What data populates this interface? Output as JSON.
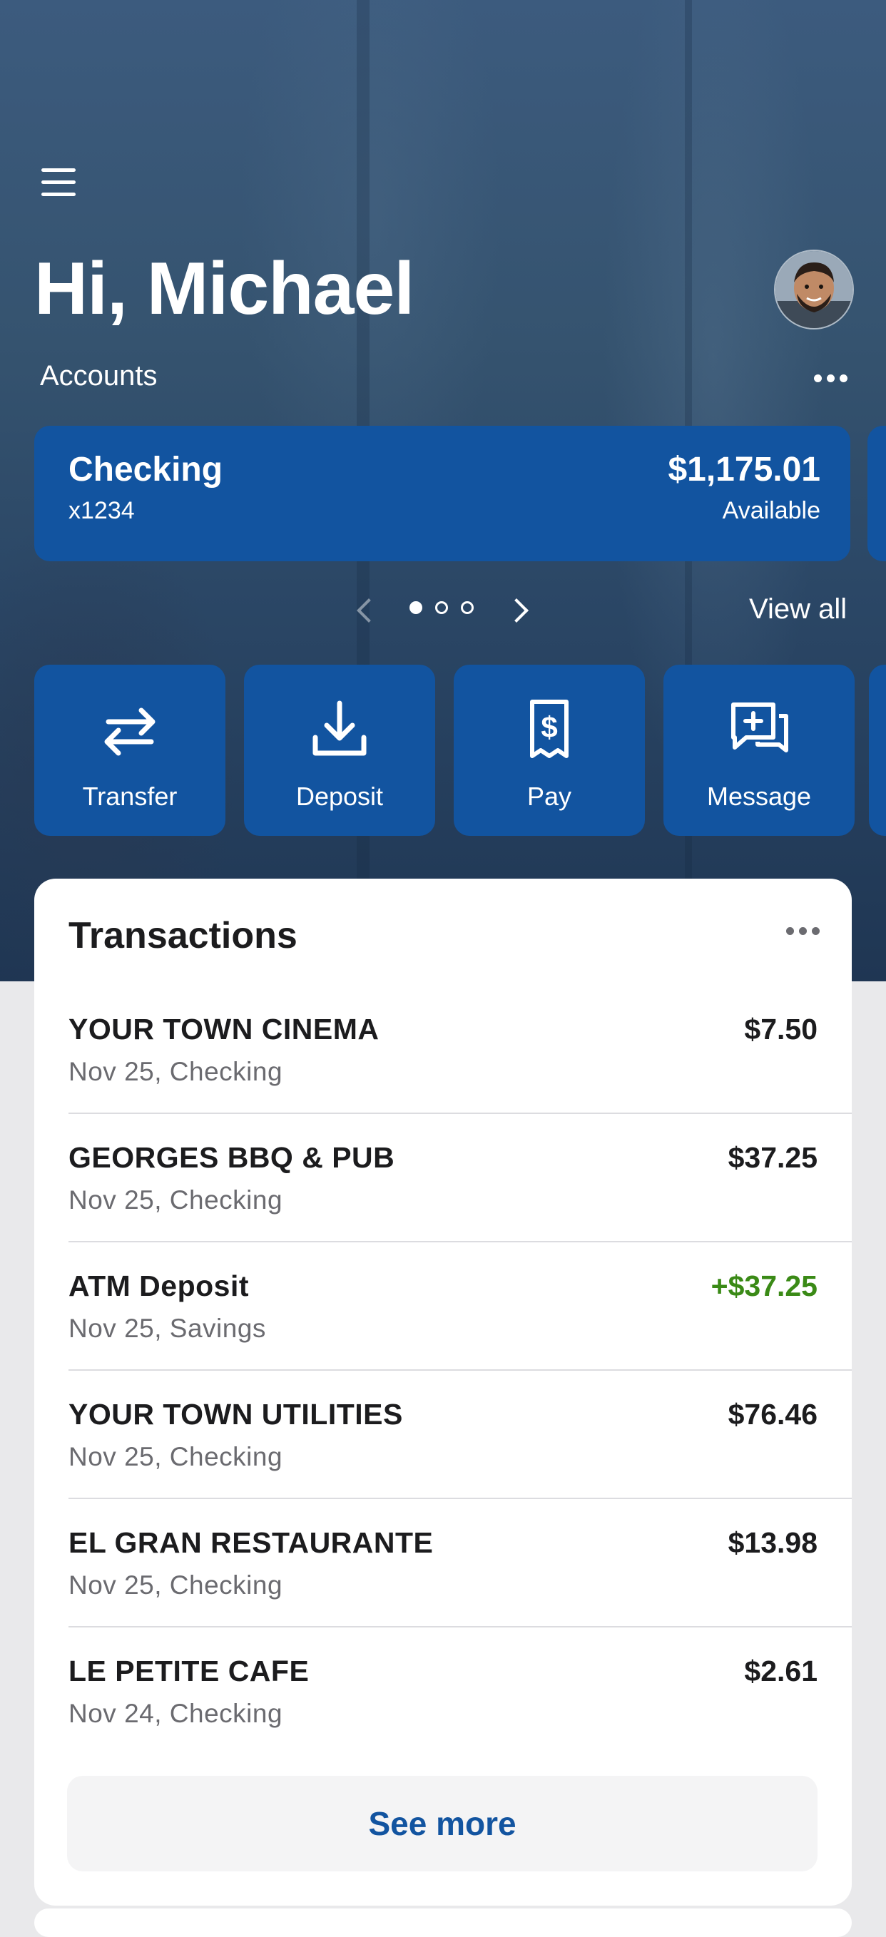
{
  "greeting": "Hi, Michael",
  "accounts": {
    "label": "Accounts",
    "cards": [
      {
        "name": "Checking",
        "number": "x1234",
        "balance": "$1,175.01",
        "balance_label": "Available"
      }
    ],
    "pager": {
      "total_pages": 3,
      "current_page": 1
    },
    "view_all_label": "View all"
  },
  "actions": [
    {
      "label": "Transfer",
      "icon": "transfer-arrows-icon"
    },
    {
      "label": "Deposit",
      "icon": "download-tray-icon"
    },
    {
      "label": "Pay",
      "icon": "receipt-dollar-icon"
    },
    {
      "label": "Message",
      "icon": "chat-plus-icon"
    }
  ],
  "transactions": {
    "title": "Transactions",
    "items": [
      {
        "description": "YOUR TOWN CINEMA",
        "meta": "Nov 25, Checking",
        "amount": "$7.50",
        "type": "debit"
      },
      {
        "description": "GEORGES BBQ & PUB",
        "meta": "Nov 25, Checking",
        "amount": "$37.25",
        "type": "debit"
      },
      {
        "description": "ATM Deposit",
        "meta": "Nov 25, Savings",
        "amount": "+$37.25",
        "type": "credit"
      },
      {
        "description": "YOUR TOWN UTILITIES",
        "meta": "Nov 25, Checking",
        "amount": "$76.46",
        "type": "debit"
      },
      {
        "description": "EL GRAN RESTAURANTE",
        "meta": "Nov 25, Checking",
        "amount": "$13.98",
        "type": "debit"
      },
      {
        "description": "LE PETITE CAFE",
        "meta": "Nov 24, Checking",
        "amount": "$2.61",
        "type": "debit"
      }
    ],
    "see_more_label": "See more"
  },
  "colors": {
    "brand_blue": "#1254a0",
    "credit_green": "#3a8a16",
    "secondary_text": "#6b6b70"
  }
}
